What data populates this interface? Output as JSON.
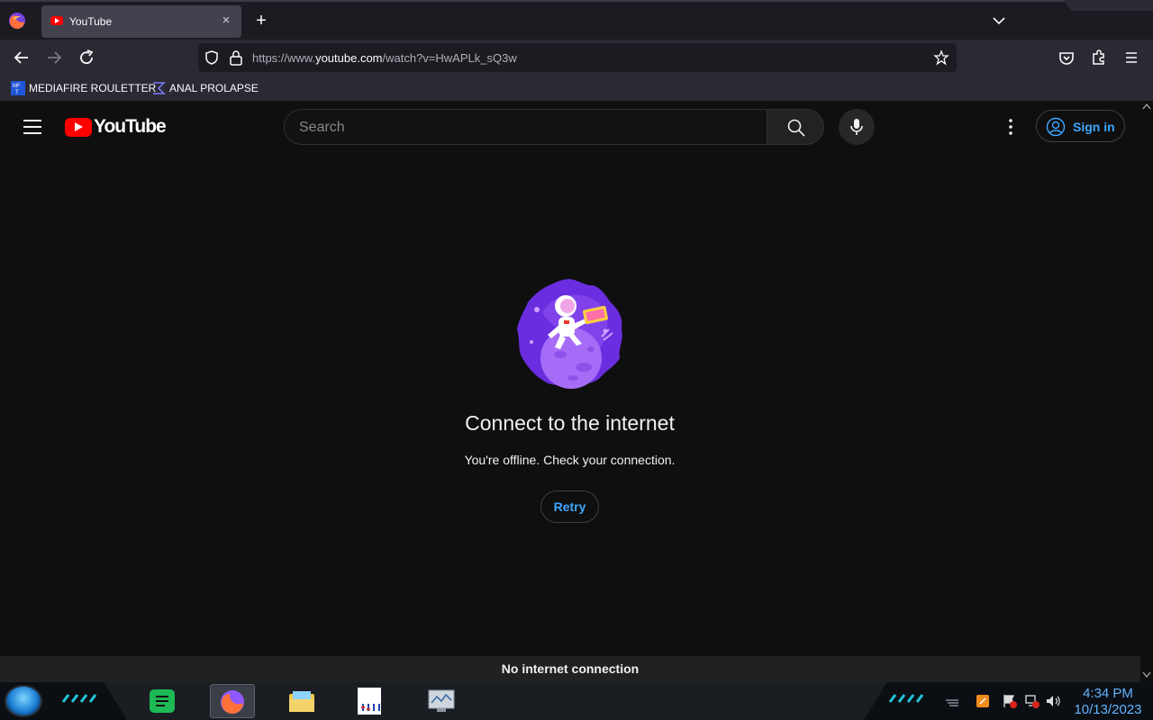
{
  "browser": {
    "tab": {
      "title": "YouTube",
      "close": "×"
    },
    "new_tab": "+",
    "url_prefix": "https://www.",
    "url_host": "youtube.com",
    "url_path": "/watch?v=HwAPLk_sQ3w",
    "bookmarks": [
      {
        "label": "MEDIAFIRE ROULETTER",
        "icon": "mediafire-icon"
      },
      {
        "label": "ANAL PROLAPSE",
        "icon": "sigma-icon"
      }
    ]
  },
  "youtube": {
    "logo_text": "YouTube",
    "search_placeholder": "Search",
    "signin_label": "Sign in",
    "offline_title": "Connect to the internet",
    "offline_subtitle": "You're offline. Check your connection.",
    "retry_label": "Retry",
    "banner": "No internet connection"
  },
  "taskbar": {
    "time": "4:34 PM",
    "date": "10/13/2023",
    "apps": [
      "spotify-icon",
      "firefox-icon",
      "file-explorer-icon",
      "document-icon",
      "monitor-icon"
    ]
  },
  "colors": {
    "accent": "#3ea6ff",
    "brand": "#ff0000",
    "clock": "#63b3ff"
  }
}
